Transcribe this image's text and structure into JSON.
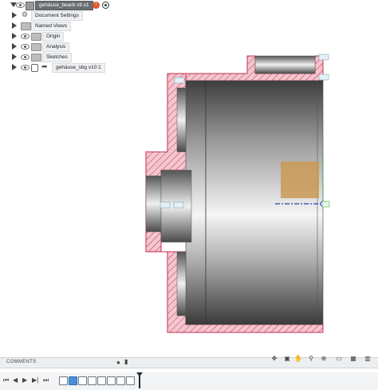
{
  "browser": {
    "root_label": "gehäuse_bearb v9 v1",
    "items": [
      {
        "label": "Document Settings",
        "icon": "gear-icon"
      },
      {
        "label": "Named Views",
        "icon": "folder-icon"
      },
      {
        "label": "Origin",
        "icon": "folder-icon"
      },
      {
        "label": "Analysis",
        "icon": "folder-icon"
      },
      {
        "label": "Sketches",
        "icon": "folder-icon"
      },
      {
        "label": "gehäuse_sbg v10:1",
        "icon": "component-icon"
      }
    ]
  },
  "comments": {
    "label": "COMMENTS",
    "add_icon": "plus-icon",
    "collapse_icon": "collapse-icon"
  },
  "colors": {
    "section_fill": "#f4c6cf",
    "section_stroke": "#c0324f",
    "metal_dark": "#3f3f3f",
    "metal_light": "#f2f2f2",
    "highlight_box": "#c99a55",
    "sketch_line": "#2a3fb0",
    "constraint": "#35a345"
  },
  "timeline": {
    "controls": [
      "first-icon",
      "previous-icon",
      "play-icon",
      "next-icon",
      "last-icon"
    ]
  }
}
